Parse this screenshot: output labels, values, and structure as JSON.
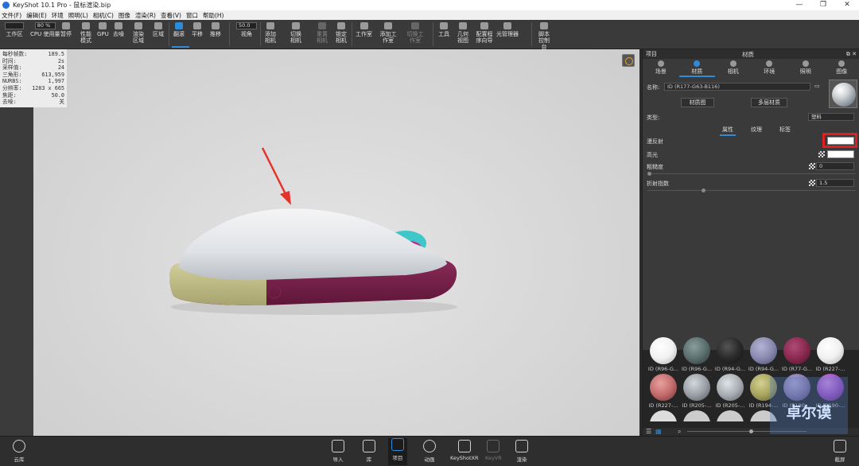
{
  "titlebar": {
    "title": "KeyShot 10.1 Pro - 鼠标渲染.bip",
    "controls": [
      "—",
      "❐",
      "✕"
    ]
  },
  "menu": [
    "文件(F)",
    "编辑(E)",
    "环境",
    "照明(L)",
    "相机(C)",
    "图像",
    "渲染(R)",
    "查看(V)",
    "窗口",
    "帮助(H)"
  ],
  "toolbar": {
    "workspace": "工作区",
    "cpu_value": "80 %",
    "cpu_label": "CPU 使用量",
    "pause": "暂停",
    "perf_mode": "性能模式",
    "gpu": "GPU",
    "denoise": "去噪",
    "render_region": "渲染区域",
    "region": "区域",
    "tumble": "翻滚",
    "pan": "平移",
    "dolly": "推移",
    "fov_value": "50.0",
    "fov": "视角",
    "add_camera": "添加相机",
    "switch_camera": "切换相机",
    "reset_camera": "重置相机",
    "lock_camera": "锁定相机",
    "studio": "工作室",
    "add_studio": "添加工作室",
    "switch_studio": "切换工作室",
    "tools": "工具",
    "geometry_view": "几何视图",
    "config_wizard": "配置程序向导",
    "light_manager": "光管理器",
    "script_console": "脚本控制台"
  },
  "stats": [
    {
      "k": "每秒帧数:",
      "v": "189.5"
    },
    {
      "k": "时间:",
      "v": "2s"
    },
    {
      "k": "采样值:",
      "v": "24"
    },
    {
      "k": "三角形:",
      "v": "613,959"
    },
    {
      "k": "NURBS:",
      "v": "1,997"
    },
    {
      "k": "分辨率:",
      "v": "1283 x 665"
    },
    {
      "k": "焦距:",
      "v": "50.0"
    },
    {
      "k": "去噪:",
      "v": "关"
    }
  ],
  "panel": {
    "project": "项目",
    "title": "材质",
    "tabs": [
      "场景",
      "材质",
      "相机",
      "环境",
      "照明",
      "图像"
    ],
    "name_label": "名称:",
    "name_value": "ID (R177-G63-B116)",
    "material_graph": "材质图",
    "multi_material": "多层材质",
    "type_label": "类型:",
    "type_value": "塑料",
    "subtabs": [
      "属性",
      "纹理",
      "标签"
    ],
    "diffuse": "漫反射",
    "specular": "高光",
    "roughness": "粗糙度",
    "roughness_value": "0",
    "ior": "折射指数",
    "ior_value": "1.5"
  },
  "library": {
    "items_top": [
      "ID (R96-G...",
      "ID (R96-G...",
      "ID (R94-G...",
      "ID (R94-G...",
      "ID (R77-G...",
      "ID (R227-..."
    ],
    "items_mid": [
      "ID (R227-...",
      "ID (R205-...",
      "ID (R205-...",
      "ID (R194-...",
      "ID (R190-...",
      "ID (R190-..."
    ],
    "colors_top": [
      "#f2f2f2",
      "#5c6f6f",
      "#2a2a2a",
      "#8a8ab0",
      "#8a2a50",
      "#f0f0f0"
    ],
    "colors_mid": [
      "#c46c6c",
      "#9aa0a6",
      "#a8aeb3",
      "#a8a560",
      "#8a7aa8",
      "#a04fc0"
    ]
  },
  "bottombar": [
    "云库",
    "导入",
    "库",
    "项目",
    "动画",
    "KeyShotXR",
    "KeyVR",
    "渲染",
    "截屏"
  ],
  "watermark": "卓尔谟"
}
